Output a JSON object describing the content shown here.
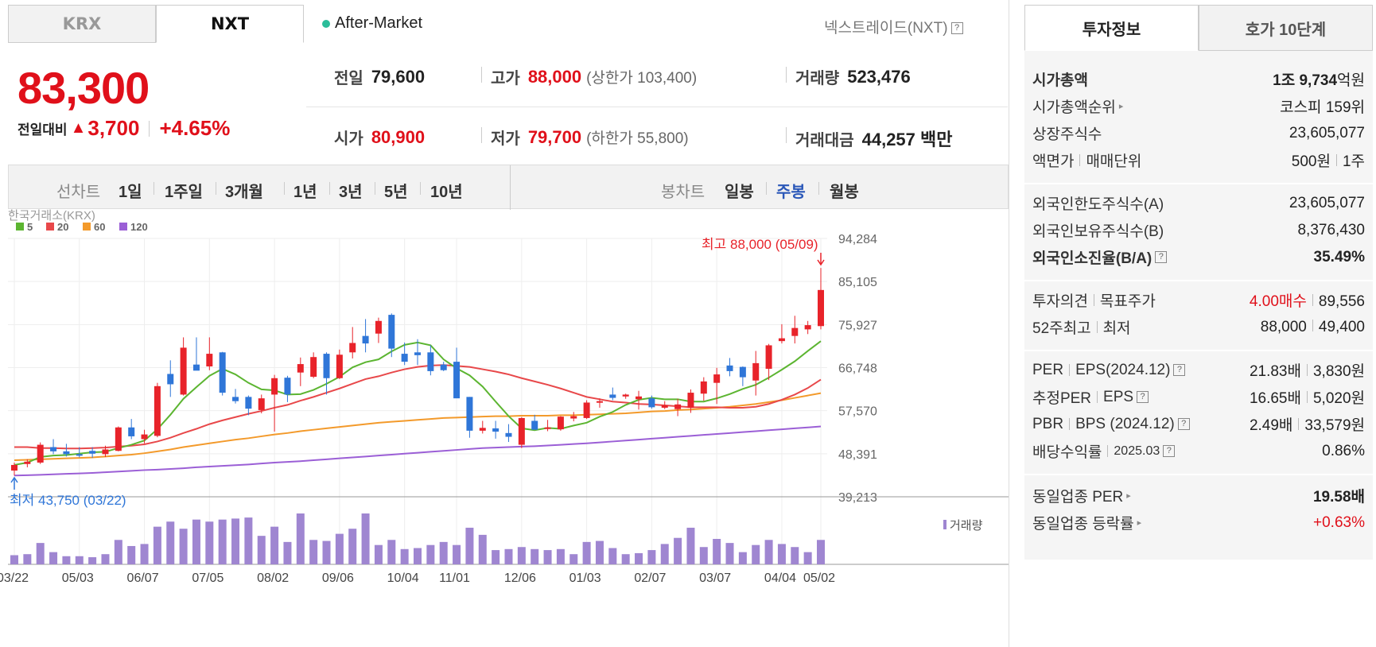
{
  "tabs": {
    "krx": "KRX",
    "nxt": "NXT"
  },
  "after_market": "After-Market",
  "nxt_title": "넥스트레이드(NXT)",
  "help_icon": "?",
  "price": "83,300",
  "diff": {
    "label": "전일대비",
    "arrow": "▲",
    "value": "3,700",
    "pct": "+4.65%"
  },
  "stats": {
    "prev_label": "전일",
    "prev": "79,600",
    "high_label": "고가",
    "high": "88,000",
    "upper_limit": "(상한가 103,400)",
    "volume_label": "거래량",
    "volume": "523,476",
    "open_label": "시가",
    "open": "80,900",
    "low_label": "저가",
    "low": "79,700",
    "lower_limit": "(하한가 55,800)",
    "amount_label": "거래대금",
    "amount": "44,257 백만"
  },
  "periods": {
    "line_label": "선차트",
    "line": [
      "1일",
      "1주일",
      "3개월",
      "1년",
      "3년",
      "5년",
      "10년"
    ],
    "candle_label": "봉차트",
    "candle": [
      "일봉",
      "주봉",
      "월봉"
    ]
  },
  "chart_data": {
    "type": "candlestick",
    "source": "한국거래소(KRX)",
    "legend": [
      "5",
      "20",
      "60",
      "120"
    ],
    "legend_colors": [
      "#5cb531",
      "#e8484a",
      "#f39a2b",
      "#9b5fd6"
    ],
    "y_ticks": [
      94284,
      85105,
      75927,
      66748,
      57570,
      48391,
      39213
    ],
    "y_tick_labels": [
      "94,284",
      "85,105",
      "75,927",
      "66,748",
      "57,570",
      "48,391",
      "39,213"
    ],
    "ylim": [
      39213,
      94284
    ],
    "x_tick_labels": [
      "03/22",
      "05/03",
      "06/07",
      "07/05",
      "08/02",
      "09/06",
      "10/04",
      "11/01",
      "12/06",
      "01/03",
      "02/07",
      "03/07",
      "04/04",
      "05/02"
    ],
    "high_annotation": "최고 88,000 (05/09)",
    "low_annotation": "최저 43,750 (03/22)",
    "volume_legend": "거래량",
    "candles": [
      {
        "o": 44800,
        "h": 46500,
        "l": 43750,
        "c": 46000
      },
      {
        "o": 46200,
        "h": 47200,
        "l": 45500,
        "c": 46700
      },
      {
        "o": 46500,
        "h": 50800,
        "l": 46200,
        "c": 50300
      },
      {
        "o": 49800,
        "h": 51500,
        "l": 48300,
        "c": 48900
      },
      {
        "o": 48900,
        "h": 50500,
        "l": 47800,
        "c": 48300
      },
      {
        "o": 48300,
        "h": 49800,
        "l": 47600,
        "c": 48100
      },
      {
        "o": 49000,
        "h": 49800,
        "l": 47500,
        "c": 48400
      },
      {
        "o": 48300,
        "h": 50100,
        "l": 47700,
        "c": 49300
      },
      {
        "o": 49000,
        "h": 54200,
        "l": 48900,
        "c": 54000
      },
      {
        "o": 54000,
        "h": 55800,
        "l": 51500,
        "c": 52100
      },
      {
        "o": 51500,
        "h": 53500,
        "l": 50600,
        "c": 52500
      },
      {
        "o": 52200,
        "h": 63500,
        "l": 51900,
        "c": 62800
      },
      {
        "o": 65400,
        "h": 68300,
        "l": 60500,
        "c": 63200
      },
      {
        "o": 61000,
        "h": 73200,
        "l": 60800,
        "c": 71000
      },
      {
        "o": 67400,
        "h": 73200,
        "l": 66200,
        "c": 66100
      },
      {
        "o": 67000,
        "h": 73200,
        "l": 66200,
        "c": 69700
      },
      {
        "o": 70000,
        "h": 70100,
        "l": 60800,
        "c": 61400
      },
      {
        "o": 60500,
        "h": 62200,
        "l": 59100,
        "c": 59600
      },
      {
        "o": 60500,
        "h": 60800,
        "l": 56600,
        "c": 58000
      },
      {
        "o": 57700,
        "h": 61000,
        "l": 57000,
        "c": 60200
      },
      {
        "o": 61000,
        "h": 65200,
        "l": 53100,
        "c": 64500
      },
      {
        "o": 64600,
        "h": 65000,
        "l": 59400,
        "c": 61000
      },
      {
        "o": 65700,
        "h": 68900,
        "l": 62800,
        "c": 67500
      },
      {
        "o": 64800,
        "h": 70000,
        "l": 64500,
        "c": 69000
      },
      {
        "o": 69700,
        "h": 70000,
        "l": 61000,
        "c": 64500
      },
      {
        "o": 64500,
        "h": 70600,
        "l": 64300,
        "c": 69500
      },
      {
        "o": 70000,
        "h": 75400,
        "l": 68700,
        "c": 72000
      },
      {
        "o": 73500,
        "h": 77100,
        "l": 70000,
        "c": 71900
      },
      {
        "o": 74000,
        "h": 77400,
        "l": 72000,
        "c": 76700
      },
      {
        "o": 78000,
        "h": 78300,
        "l": 69000,
        "c": 70800
      },
      {
        "o": 69700,
        "h": 72100,
        "l": 67300,
        "c": 68000
      },
      {
        "o": 70000,
        "h": 72800,
        "l": 67300,
        "c": 69400
      },
      {
        "o": 70000,
        "h": 71500,
        "l": 65100,
        "c": 66000
      },
      {
        "o": 67400,
        "h": 68000,
        "l": 66000,
        "c": 66200
      },
      {
        "o": 68000,
        "h": 71000,
        "l": 60300,
        "c": 60200
      },
      {
        "o": 60500,
        "h": 60500,
        "l": 51800,
        "c": 53300
      },
      {
        "o": 53300,
        "h": 55400,
        "l": 52700,
        "c": 53900
      },
      {
        "o": 53800,
        "h": 55400,
        "l": 51600,
        "c": 53100
      },
      {
        "o": 52800,
        "h": 54700,
        "l": 50900,
        "c": 52000
      },
      {
        "o": 50300,
        "h": 56200,
        "l": 49600,
        "c": 56000
      },
      {
        "o": 55400,
        "h": 56700,
        "l": 53600,
        "c": 53500
      },
      {
        "o": 53800,
        "h": 55600,
        "l": 53200,
        "c": 54000
      },
      {
        "o": 53600,
        "h": 56400,
        "l": 53300,
        "c": 56300
      },
      {
        "o": 55900,
        "h": 57300,
        "l": 55300,
        "c": 56400
      },
      {
        "o": 56000,
        "h": 59800,
        "l": 55800,
        "c": 59300
      },
      {
        "o": 59500,
        "h": 60200,
        "l": 58200,
        "c": 59600
      },
      {
        "o": 61000,
        "h": 62500,
        "l": 59800,
        "c": 60300
      },
      {
        "o": 60600,
        "h": 61200,
        "l": 60100,
        "c": 61000
      },
      {
        "o": 60000,
        "h": 61800,
        "l": 57800,
        "c": 60600
      },
      {
        "o": 60200,
        "h": 60800,
        "l": 58000,
        "c": 58300
      },
      {
        "o": 58200,
        "h": 59600,
        "l": 57900,
        "c": 58700
      },
      {
        "o": 57900,
        "h": 60100,
        "l": 56400,
        "c": 58900
      },
      {
        "o": 58200,
        "h": 62100,
        "l": 57100,
        "c": 61400
      },
      {
        "o": 61200,
        "h": 64700,
        "l": 59700,
        "c": 63800
      },
      {
        "o": 63500,
        "h": 66700,
        "l": 59000,
        "c": 65300
      },
      {
        "o": 67200,
        "h": 68800,
        "l": 64900,
        "c": 66000
      },
      {
        "o": 66900,
        "h": 67000,
        "l": 62800,
        "c": 64700
      },
      {
        "o": 64000,
        "h": 70300,
        "l": 60800,
        "c": 67700
      },
      {
        "o": 66500,
        "h": 71800,
        "l": 64100,
        "c": 71500
      },
      {
        "o": 72400,
        "h": 76000,
        "l": 71900,
        "c": 73000
      },
      {
        "o": 73500,
        "h": 77800,
        "l": 71900,
        "c": 75200
      },
      {
        "o": 74900,
        "h": 76700,
        "l": 73900,
        "c": 75800
      },
      {
        "o": 75600,
        "h": 88000,
        "l": 74900,
        "c": 83300
      }
    ],
    "ma5": [
      46000,
      46500,
      47700,
      48000,
      48100,
      48400,
      48700,
      48800,
      49600,
      50300,
      51200,
      53600,
      56700,
      60100,
      62600,
      65000,
      66500,
      65300,
      63500,
      62100,
      61900,
      61000,
      61100,
      62000,
      63300,
      64800,
      66800,
      67900,
      68500,
      70200,
      71600,
      72100,
      71500,
      68500,
      66600,
      65100,
      62700,
      59500,
      56400,
      53800,
      53400,
      53900,
      53700,
      54400,
      55000,
      56300,
      57300,
      58800,
      59900,
      60300,
      60000,
      60000,
      59500,
      59500,
      60200,
      61100,
      62200,
      63100,
      64600,
      66300,
      68100,
      70300,
      72400
    ],
    "ma20": [
      49800,
      49800,
      49600,
      49600,
      49500,
      49500,
      49600,
      49700,
      49900,
      50100,
      50400,
      51000,
      51800,
      52800,
      53700,
      54700,
      55500,
      56200,
      56900,
      57500,
      58200,
      58800,
      59700,
      60500,
      61400,
      62300,
      63300,
      64300,
      64900,
      65700,
      66400,
      66900,
      67200,
      67300,
      67100,
      66900,
      66400,
      65900,
      65300,
      64500,
      63800,
      63100,
      62300,
      61400,
      60500,
      60000,
      59500,
      59300,
      59000,
      58900,
      58700,
      58500,
      58300,
      58300,
      58300,
      58200,
      58200,
      58400,
      59000,
      59900,
      61000,
      62400,
      64200
    ],
    "ma60": [
      47000,
      47100,
      47200,
      47300,
      47400,
      47500,
      47600,
      47800,
      48000,
      48200,
      48500,
      48900,
      49300,
      49800,
      50200,
      50600,
      51000,
      51400,
      51700,
      52100,
      52500,
      52800,
      53200,
      53500,
      53800,
      54100,
      54400,
      54700,
      55000,
      55200,
      55400,
      55600,
      55800,
      56000,
      56100,
      56200,
      56300,
      56400,
      56400,
      56500,
      56500,
      56500,
      56600,
      56600,
      56700,
      56800,
      56900,
      57000,
      57200,
      57400,
      57500,
      57700,
      57800,
      58000,
      58200,
      58400,
      58700,
      59000,
      59400,
      59800,
      60300,
      60800,
      61300
    ],
    "ma120": [
      43750,
      43800,
      43900,
      44000,
      44100,
      44200,
      44300,
      44450,
      44600,
      44750,
      44900,
      45000,
      45150,
      45300,
      45500,
      45650,
      45800,
      45950,
      46100,
      46300,
      46500,
      46650,
      46800,
      47000,
      47200,
      47400,
      47600,
      47800,
      48000,
      48200,
      48400,
      48600,
      48800,
      49000,
      49200,
      49400,
      49600,
      49700,
      49800,
      49900,
      50000,
      50150,
      50300,
      50450,
      50600,
      50800,
      51000,
      51200,
      51400,
      51600,
      51800,
      52000,
      52200,
      52400,
      52600,
      52800,
      53000,
      53200,
      53400,
      53600,
      53800,
      54000,
      54200
    ],
    "volume": [
      9,
      10,
      21,
      12,
      8,
      8,
      7,
      10,
      24,
      18,
      20,
      37,
      42,
      35,
      44,
      42,
      44,
      45,
      46,
      28,
      37,
      22,
      50,
      24,
      23,
      30,
      35,
      50,
      19,
      24,
      15,
      16,
      19,
      22,
      19,
      36,
      29,
      14,
      15,
      17,
      15,
      14,
      15,
      10,
      22,
      23,
      16,
      10,
      11,
      14,
      20,
      26,
      36,
      17,
      25,
      21,
      12,
      19,
      24,
      20,
      17,
      12,
      24
    ]
  },
  "right_tabs": {
    "info": "투자정보",
    "quote": "호가 10단계"
  },
  "info": {
    "mcap_label": "시가총액",
    "mcap_strong": "1조 9,734",
    "mcap_unit": "억원",
    "mcap_rank_label": "시가총액순위",
    "mcap_rank": "코스피 159위",
    "shares_label": "상장주식수",
    "shares": "23,605,077",
    "par_label": "액면가",
    "unit_label": "매매단위",
    "par": "500원",
    "unit": "1주",
    "foreign_limit_label": "외국인한도주식수(A)",
    "foreign_limit": "23,605,077",
    "foreign_hold_label": "외국인보유주식수(B)",
    "foreign_hold": "8,376,430",
    "foreign_ratio_label": "외국인소진율(B/A)",
    "foreign_ratio": "35.49%",
    "opinion_label": "투자의견",
    "target_label": "목표주가",
    "opinion": "4.00매수",
    "target": "89,556",
    "w52_high_label": "52주최고",
    "w52_low_label": "최저",
    "w52_high": "88,000",
    "w52_low": "49,400",
    "per_label": "PER",
    "eps_label": "EPS(2024.12)",
    "per": "21.83배",
    "eps": "3,830원",
    "est_per_label": "추정PER",
    "est_eps_label": "EPS",
    "est_per": "16.65배",
    "est_eps": "5,020원",
    "pbr_label": "PBR",
    "bps_label": "BPS (2024.12)",
    "pbr": "2.49배",
    "bps": "33,579원",
    "div_label": "배당수익률",
    "div_date": "2025.03",
    "div": "0.86%",
    "sector_per_label": "동일업종 PER",
    "sector_per": "19.58배",
    "sector_chg_label": "동일업종 등락률",
    "sector_chg": "+0.63%"
  }
}
